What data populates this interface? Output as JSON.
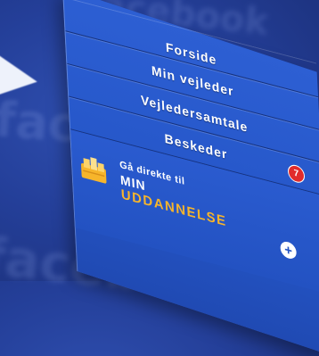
{
  "background": {
    "word": "facebook",
    "color": "#2a49a8"
  },
  "menu": {
    "items": [
      {
        "label": "Forside"
      },
      {
        "label": "Min vejleder"
      },
      {
        "label": "Vejledersamtale"
      },
      {
        "label": "Beskeder",
        "badge": "7"
      }
    ]
  },
  "promo": {
    "small": "Gå direkte til",
    "line1": "MIN",
    "line2": "UDDANNELSE",
    "accent_color": "#f7b52b",
    "logo_icon": "books-icon",
    "button_icon": "plus-icon"
  }
}
